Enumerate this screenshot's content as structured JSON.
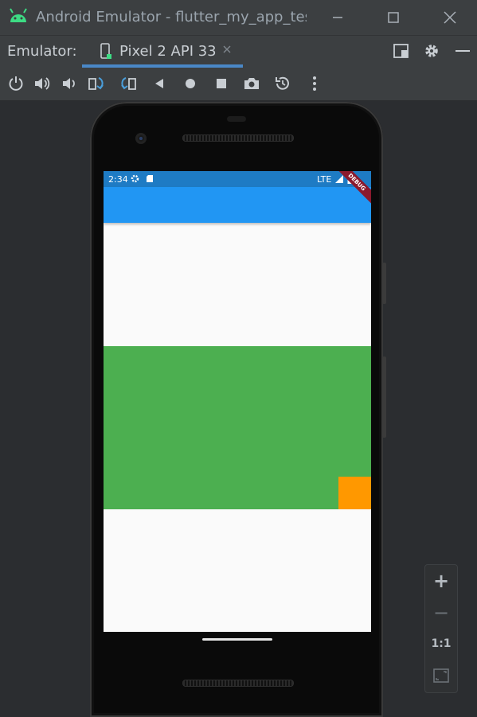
{
  "window": {
    "title": "Android Emulator - flutter_my_app_test",
    "icons": [
      "android-icon",
      "minimize-icon",
      "maximize-icon",
      "close-icon"
    ]
  },
  "tabbar": {
    "label": "Emulator:",
    "tab_label": "Pixel 2 API 33",
    "icons": [
      "device-icon",
      "tab-close-icon",
      "layout-icon",
      "settings-icon",
      "hide-icon"
    ]
  },
  "toolbar": {
    "icons": [
      "power-icon",
      "volume-up-icon",
      "volume-down-icon",
      "rotate-left-icon",
      "rotate-right-icon",
      "back-icon",
      "home-icon",
      "overview-icon",
      "screenshot-icon",
      "snapshot-icon",
      "more-icon"
    ]
  },
  "device": {
    "status_time": "2:34",
    "status_network": "LTE",
    "debug_banner": "DEBUG",
    "colors": {
      "status_bar": "#1e7bc4",
      "app_bar": "#2196f3",
      "background": "#fafafa",
      "green_box": "#4caf50",
      "orange_box": "#ff9800"
    }
  },
  "zoom": {
    "plus": "+",
    "minus": "−",
    "one_to_one": "1:1",
    "icons": [
      "fit-screen-icon"
    ]
  }
}
